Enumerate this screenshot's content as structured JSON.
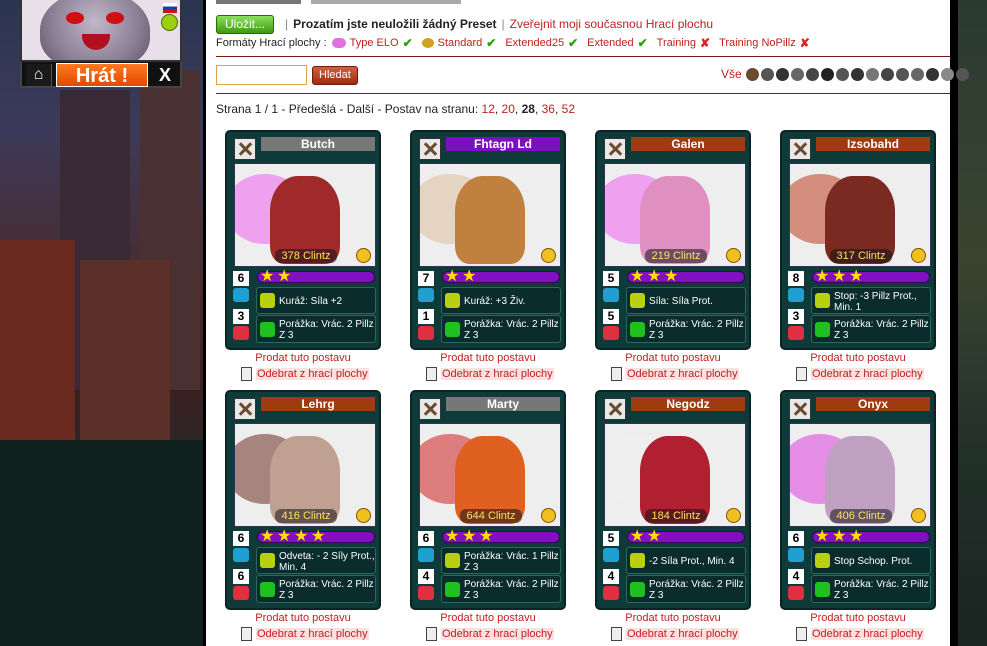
{
  "user": {
    "play_label": "Hrát !",
    "close_label": "X"
  },
  "preset": {
    "save_label": "Uložit...",
    "status": "Prozatím jste neuložili žádný Preset",
    "publish_link": "Zveřejnit moji současnou Hrací plochu"
  },
  "formats": {
    "label": "Formáty Hrací plochy :",
    "items": [
      {
        "name": "Type ELO",
        "allowed": true,
        "icon": "pill-icon"
      },
      {
        "name": "Standard",
        "allowed": true,
        "icon": "standard-icon"
      },
      {
        "name": "Extended25",
        "allowed": true,
        "icon": ""
      },
      {
        "name": "Extended",
        "allowed": true,
        "icon": ""
      },
      {
        "name": "Training",
        "allowed": false,
        "icon": ""
      },
      {
        "name": "Training NoPillz",
        "allowed": false,
        "icon": ""
      }
    ],
    "ok_mark": "✔",
    "no_mark": "✘"
  },
  "search": {
    "placeholder": "",
    "value": "",
    "button_label": "Hledat"
  },
  "filter": {
    "all_label": "Vše"
  },
  "pager": {
    "page_text": "Strana 1 / 1",
    "prev": "Předešlá",
    "next": "Další",
    "per_page_label": "Postav na stranu:",
    "options": [
      "12",
      "20",
      "28",
      "36",
      "52"
    ],
    "current": "28"
  },
  "actions": {
    "sell": "Prodat tuto postavu",
    "remove": "Odebrat z hrací plochy"
  },
  "cards": [
    {
      "name": "Butch",
      "clan_color": "#777777",
      "clintz": "378 Clintz",
      "stars": 2,
      "power": "6",
      "damage": "3",
      "ability": "Kuráž: Síla +2",
      "bonus": "Porážka: Vrác. 2 Pillz Z 3"
    },
    {
      "name": "Fhtagn Ld",
      "clan_color": "#7a10c0",
      "clintz": "",
      "stars": 2,
      "power": "7",
      "damage": "1",
      "ability": "Kuráž: +3 Živ.",
      "bonus": "Porážka: Vrác. 2 Pillz Z 3"
    },
    {
      "name": "Galen",
      "clan_color": "#a03a10",
      "clintz": "219 Clintz",
      "stars": 3,
      "power": "5",
      "damage": "5",
      "ability": "Síla: Síla Prot.",
      "bonus": "Porážka: Vrác. 2 Pillz Z 3"
    },
    {
      "name": "Izsobahd",
      "clan_color": "#a03a10",
      "clintz": "317 Clintz",
      "stars": 3,
      "power": "8",
      "damage": "3",
      "ability": "Stop: -3 Pillz Prot., Min. 1",
      "bonus": "Porážka: Vrác. 2 Pillz Z 3"
    },
    {
      "name": "Lehrg",
      "clan_color": "#a03a10",
      "clintz": "416 Clintz",
      "stars": 4,
      "power": "6",
      "damage": "6",
      "ability": "Odveta: - 2 Síly Prot., Min. 4",
      "bonus": "Porážka: Vrác. 2 Pillz Z 3"
    },
    {
      "name": "Marty",
      "clan_color": "#777777",
      "clintz": "644 Clintz",
      "stars": 3,
      "power": "6",
      "damage": "4",
      "ability": "Porážka: Vrác. 1 Pillz Z 3",
      "bonus": "Porážka: Vrác. 2 Pillz Z 3"
    },
    {
      "name": "Negodz",
      "clan_color": "#a03a10",
      "clintz": "184 Clintz",
      "stars": 2,
      "power": "5",
      "damage": "4",
      "ability": "-2 Síla Prot., Min. 4",
      "bonus": "Porážka: Vrác. 2 Pillz Z 3"
    },
    {
      "name": "Onyx",
      "clan_color": "#a03a10",
      "clintz": "406 Clintz",
      "stars": 3,
      "power": "6",
      "damage": "4",
      "ability": "Stop Schop. Prot.",
      "bonus": "Porážka: Vrác. 2 Pillz Z 3"
    }
  ]
}
